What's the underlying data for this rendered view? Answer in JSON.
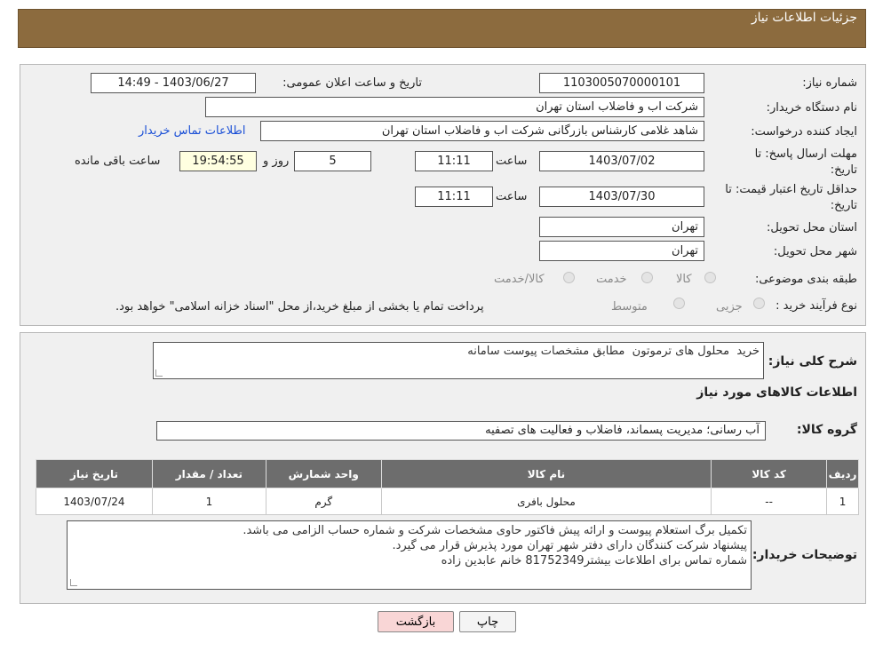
{
  "header": {
    "title": "جزئیات اطلاعات نیاز"
  },
  "need_number": {
    "label": "شماره نیاز:",
    "value": "1103005070000101"
  },
  "announce": {
    "label": "تاریخ و ساعت اعلان عمومی:",
    "value": "1403/06/27 - 14:49"
  },
  "buyer_org": {
    "label": "نام دستگاه خریدار:",
    "value": "شرکت اب و فاضلاب استان تهران"
  },
  "requester": {
    "label": "ایجاد کننده درخواست:",
    "value": "شاهد غلامی کارشناس بازرگانی شرکت اب و فاضلاب استان تهران",
    "contact_link": "اطلاعات تماس خریدار"
  },
  "reply_deadline": {
    "label_line1": "مهلت ارسال پاسخ: تا",
    "label_line2": "تاریخ:",
    "date": "1403/07/02",
    "time_label": "ساعت",
    "time": "11:11",
    "days": "5",
    "days_label": "روز و",
    "remaining": "19:54:55",
    "remaining_label": "ساعت باقی مانده"
  },
  "price_validity": {
    "label_line1": "حداقل تاریخ اعتبار قیمت: تا",
    "label_line2": "تاریخ:",
    "date": "1403/07/30",
    "time_label": "ساعت",
    "time": "11:11"
  },
  "delivery_province": {
    "label": "استان محل تحویل:",
    "value": "تهران"
  },
  "delivery_city": {
    "label": "شهر محل تحویل:",
    "value": "تهران"
  },
  "category": {
    "label": "طبقه بندی موضوعی:",
    "options": [
      "کالا",
      "خدمت",
      "کالا/خدمت"
    ]
  },
  "process_type": {
    "label": "نوع فرآیند خرید :",
    "options": [
      "جزیی",
      "متوسط"
    ],
    "note": "پرداخت تمام یا بخشی از مبلغ خرید،از محل \"اسناد خزانه اسلامی\" خواهد بود."
  },
  "description": {
    "label": "شرح کلی نیاز:",
    "value": "خرید  محلول های ترموتون  مطابق مشخصات پیوست سامانه"
  },
  "goods_info": {
    "title": "اطلاعات کالاهای مورد نیاز"
  },
  "goods_group": {
    "label": "گروه کالا:",
    "value": "آب رسانی؛ مدیریت پسماند، فاضلاب و فعالیت های تصفیه"
  },
  "items_table": {
    "columns": [
      "ردیف",
      "کد کالا",
      "نام کالا",
      "واحد شمارش",
      "تعداد / مقدار",
      "تاریخ نیاز"
    ],
    "rows": [
      [
        "1",
        "--",
        "محلول بافری",
        "گرم",
        "1",
        "1403/07/24"
      ]
    ]
  },
  "buyer_notes": {
    "label": "توضیحات خریدار:",
    "lines": [
      "تکمیل برگ استعلام پیوست و ارائه پیش فاکتور حاوی مشخصات شرکت و شماره حساب الزامی می باشد.",
      "پیشنهاد شرکت کنندگان دارای دفتر شهر تهران مورد پذیرش قرار می گیرد.",
      "شماره تماس برای اطلاعات بیشتر81752349 خانم عابدین زاده"
    ]
  },
  "actions": {
    "print": "چاپ",
    "back": "بازگشت"
  },
  "colors": {
    "header": "#8c6b3e",
    "table_header": "#6d6d6d",
    "link": "#1a4fd6",
    "back_button": "#f9d6d6"
  }
}
